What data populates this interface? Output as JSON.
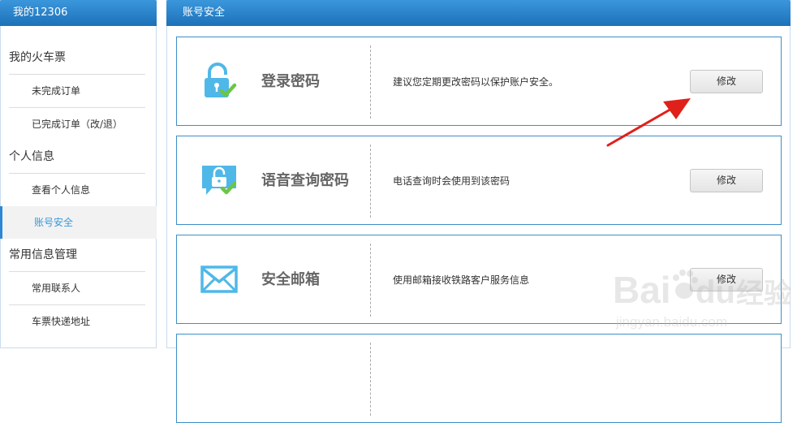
{
  "sidebar": {
    "title": "我的12306",
    "sections": [
      {
        "label": "我的火车票",
        "items": [
          "未完成订单",
          "已完成订单（改/退）"
        ]
      },
      {
        "label": "个人信息",
        "items": [
          "查看个人信息",
          "账号安全"
        ]
      },
      {
        "label": "常用信息管理",
        "items": [
          "常用联系人",
          "车票快递地址"
        ]
      }
    ],
    "active_item": "账号安全"
  },
  "main": {
    "title": "账号安全",
    "cards": [
      {
        "title": "登录密码",
        "desc": "建议您定期更改密码以保护账户安全。",
        "button": "修改",
        "icon": "lock-check-icon"
      },
      {
        "title": "语音查询密码",
        "desc": "电话查询时会使用到该密码",
        "button": "修改",
        "icon": "speech-lock-icon"
      },
      {
        "title": "安全邮箱",
        "desc": "使用邮箱接收铁路客户服务信息",
        "button": "修改",
        "icon": "envelope-icon"
      }
    ]
  },
  "watermark": {
    "brand": "Bai",
    "brand2": "du",
    "cn": "经验",
    "url": "jingyan.baidu.com"
  },
  "colors": {
    "header_blue": "#1c71b8",
    "card_border": "#3d8fc8",
    "icon_blue": "#4fb8e8",
    "check_green": "#6cc644",
    "arrow_red": "#e0201a"
  }
}
